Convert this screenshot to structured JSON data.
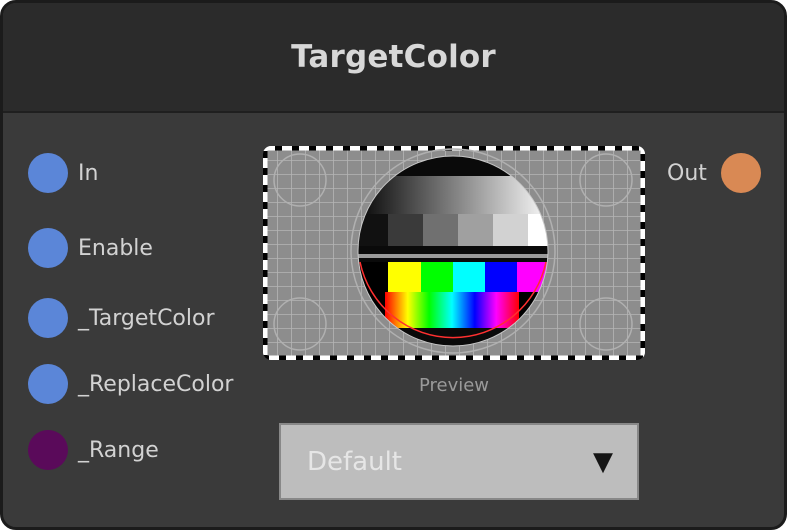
{
  "node": {
    "title": "TargetColor",
    "inputs": [
      {
        "label": "In",
        "color": "#5b86d8"
      },
      {
        "label": "Enable",
        "color": "#5b86d8"
      },
      {
        "label": "_TargetColor",
        "color": "#5b86d8"
      },
      {
        "label": "_ReplaceColor",
        "color": "#5b86d8"
      },
      {
        "label": "_Range",
        "color": "#5a0a5a"
      }
    ],
    "outputs": [
      {
        "label": "Out",
        "color": "#d98954"
      }
    ],
    "preview": {
      "label": "Preview"
    },
    "dropdown": {
      "value": "Default",
      "arrow_icon": "triangle-down-icon"
    }
  }
}
